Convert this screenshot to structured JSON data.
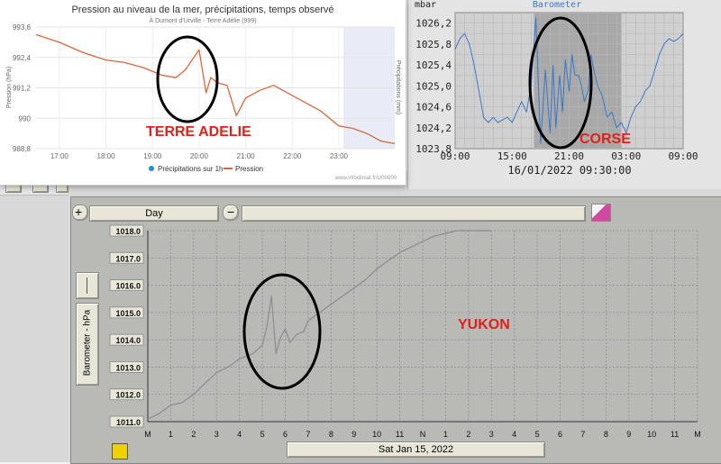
{
  "colors": {
    "red": "#e0201a",
    "orange": "#d9663a",
    "blue": "#3a78c8",
    "gray_line": "#8c8c8c"
  },
  "labels": {
    "terre": "TERRE ADELIE",
    "corse": "CORSE",
    "yukon": "YUKON"
  },
  "yukon_ui": {
    "period": "Day",
    "date": "Sat Jan 15, 2022",
    "axis_label": "Barometer - hPa",
    "zoom_in_icon": "zoom-in-icon",
    "zoom_out_icon": "zoom-out-icon",
    "lock_icon": "lock-icon"
  },
  "chart_data": [
    {
      "type": "line",
      "title": "Pression au niveau de la mer, précipitations, temps observé",
      "subtitle": "À Dumont d'Urville - Terre Adélie (999)",
      "ylabel": "Pression (hPa)",
      "ylabel_right": "Précipitations (mm)",
      "credit": "www.infoclimat.fr/c/00000",
      "xticks": [
        "17:00",
        "18:00",
        "19:00",
        "20:00",
        "21:00",
        "22:00",
        "23:00"
      ],
      "yticks": [
        "988,8",
        "990",
        "991,2",
        "992,4",
        "993,6"
      ],
      "ylim": [
        988.8,
        993.6
      ],
      "xlim": [
        16.5,
        24.2
      ],
      "legend": [
        "Précipitations sur 1h",
        "Pression"
      ],
      "series": [
        {
          "name": "Pression",
          "x": [
            16.5,
            17.0,
            17.5,
            18.0,
            18.4,
            18.8,
            19.2,
            19.5,
            19.7,
            19.85,
            20.0,
            20.15,
            20.25,
            20.4,
            20.6,
            20.8,
            21.0,
            21.3,
            21.6,
            22.0,
            22.3,
            22.6,
            23.0,
            23.3,
            23.6,
            23.9,
            24.2
          ],
          "y": [
            993.3,
            993.0,
            992.6,
            992.3,
            992.2,
            992.0,
            991.7,
            991.6,
            991.9,
            992.3,
            992.7,
            991.0,
            991.6,
            991.4,
            991.3,
            990.1,
            990.8,
            991.1,
            991.3,
            990.9,
            990.6,
            990.3,
            989.7,
            989.6,
            989.4,
            989.1,
            989.0
          ]
        }
      ]
    },
    {
      "type": "line",
      "ylabel": "mbar",
      "title": "Barometer",
      "xticks": [
        "09:00",
        "15:00",
        "21:00",
        "03:00",
        "09:00"
      ],
      "yticks": [
        "1023,8",
        "1024,2",
        "1024,6",
        "1025,0",
        "1025,4",
        "1025,8",
        "1026,2"
      ],
      "ylim": [
        1023.8,
        1026.4
      ],
      "xlim": [
        0,
        24
      ],
      "date_label": "16/01/2022  09:30:00",
      "series": [
        {
          "name": "Barometer",
          "x": [
            0,
            0.5,
            1,
            1.5,
            2,
            2.5,
            3,
            3.5,
            4,
            4.5,
            5,
            5.5,
            6,
            6.5,
            7,
            7.5,
            8,
            8.5,
            9,
            9.5,
            10,
            10.3,
            10.6,
            11,
            11.3,
            11.6,
            12,
            12.3,
            12.6,
            13,
            13.3,
            13.6,
            14,
            14.3,
            14.6,
            15,
            15.5,
            16,
            16.5,
            17,
            17.5,
            18,
            18.5,
            19,
            19.5,
            20,
            20.5,
            21,
            21.5,
            22,
            22.5,
            23,
            23.5,
            24
          ],
          "y": [
            1025.7,
            1025.9,
            1026.0,
            1025.8,
            1025.4,
            1024.9,
            1024.4,
            1024.3,
            1024.4,
            1024.3,
            1024.35,
            1024.4,
            1024.3,
            1024.5,
            1024.7,
            1024.5,
            1025.0,
            1026.3,
            1023.9,
            1025.3,
            1024.1,
            1025.4,
            1024.2,
            1025.2,
            1024.5,
            1025.5,
            1024.9,
            1025.6,
            1025.2,
            1025.2,
            1025.0,
            1024.7,
            1024.9,
            1025.6,
            1025.3,
            1025.0,
            1024.8,
            1024.4,
            1024.5,
            1024.2,
            1024.3,
            1024.1,
            1024.4,
            1024.6,
            1024.7,
            1024.9,
            1025.0,
            1025.3,
            1025.6,
            1025.8,
            1025.9,
            1025.85,
            1025.9,
            1026.0
          ]
        }
      ]
    },
    {
      "type": "line",
      "ylabel": "Barometer - hPa",
      "xticks": [
        "M",
        "1",
        "2",
        "3",
        "4",
        "5",
        "6",
        "7",
        "8",
        "9",
        "10",
        "11",
        "N",
        "1",
        "2",
        "3",
        "4",
        "5",
        "6",
        "7",
        "8",
        "9",
        "10",
        "11",
        "M"
      ],
      "yticks": [
        "1011.0",
        "1012.0",
        "1013.0",
        "1014.0",
        "1015.0",
        "1016.0",
        "1017.0",
        "1018.0"
      ],
      "ylim": [
        1011,
        1018
      ],
      "xlim": [
        0,
        24
      ],
      "series": [
        {
          "name": "Barometer",
          "x": [
            0,
            0.5,
            1,
            1.5,
            2,
            2.5,
            3,
            3.5,
            4,
            4.3,
            4.6,
            5,
            5.2,
            5.4,
            5.5,
            5.6,
            5.8,
            6.0,
            6.2,
            6.5,
            6.8,
            7,
            7.5,
            8,
            8.5,
            9,
            9.5,
            10,
            10.5,
            11,
            11.5,
            12,
            12.5,
            13,
            13.5,
            14,
            14.5,
            15
          ],
          "y": [
            1011.1,
            1011.3,
            1011.6,
            1011.7,
            1012.0,
            1012.4,
            1012.8,
            1013.0,
            1013.3,
            1013.4,
            1013.5,
            1013.8,
            1014.5,
            1015.6,
            1014.5,
            1013.5,
            1014.1,
            1014.4,
            1013.9,
            1014.2,
            1014.3,
            1014.7,
            1015.0,
            1015.3,
            1015.6,
            1015.9,
            1016.2,
            1016.6,
            1016.9,
            1017.2,
            1017.4,
            1017.6,
            1017.8,
            1017.9,
            1018.0,
            1018.0,
            1018.0,
            1018.0
          ]
        }
      ]
    }
  ]
}
